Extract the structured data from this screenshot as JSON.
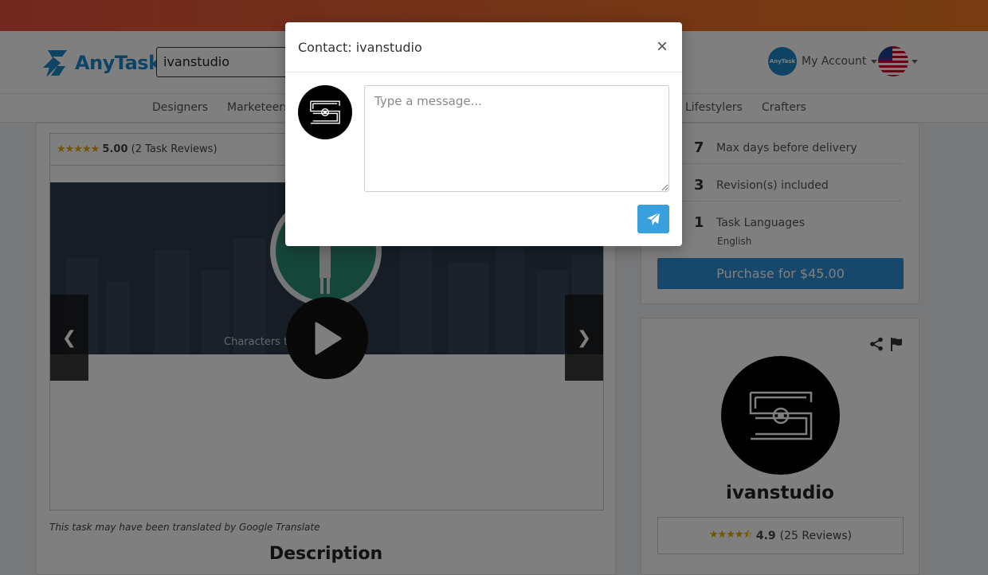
{
  "header": {
    "logo_text": "AnyTask",
    "search_value": "ivanstudio",
    "account_label": "My Account",
    "account_avatar_text": "AnyTask"
  },
  "categories": [
    {
      "label": "Designers"
    },
    {
      "label": "Marketeers"
    },
    {
      "label": "Lifestylers"
    },
    {
      "label": "Crafters"
    }
  ],
  "task": {
    "rating": "5.00",
    "reviews": "(2 Task Reviews)",
    "video_caption": "Characters t                & cultures",
    "translated_note": "This task may have been translated by Google Translate",
    "description_title": "Description"
  },
  "specs": [
    {
      "num": "7",
      "label": "Max days before delivery"
    },
    {
      "num": "3",
      "label": "Revision(s) included"
    },
    {
      "num": "1",
      "label": "Task Languages",
      "sub": "English"
    }
  ],
  "purchase_label": "Purchase for $45.00",
  "seller": {
    "name": "ivanstudio",
    "rating": "4.9",
    "reviews": "(25 Reviews)"
  },
  "modal": {
    "title": "Contact: ivanstudio",
    "close_glyph": "×",
    "message_placeholder": "Type a message..."
  },
  "colors": {
    "brand": "#1f86c9",
    "purchase": "#2f8fd6",
    "send": "#3aa0dd",
    "star": "#e6a800"
  }
}
